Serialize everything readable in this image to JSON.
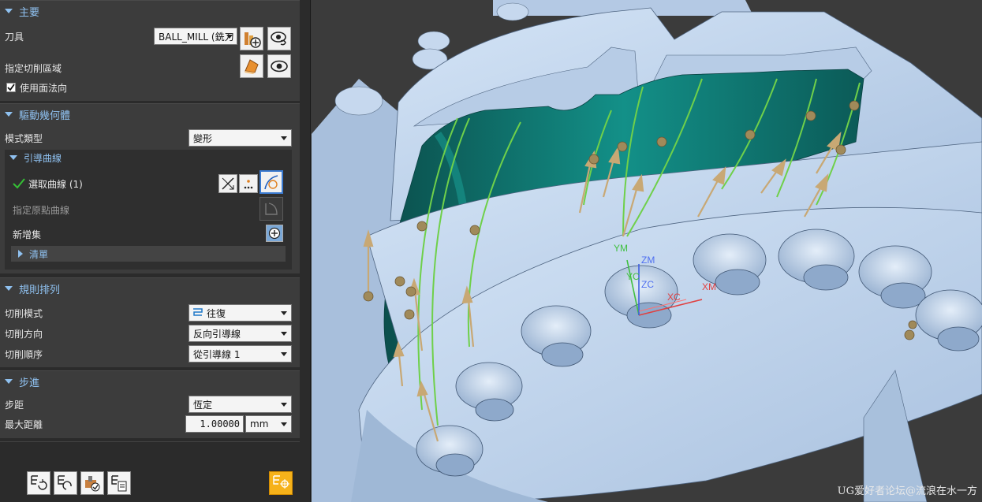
{
  "colors": {
    "panel_bg": "#2b2b2b",
    "group_bg": "#3c3c3c",
    "accent_header": "#8fc1f0",
    "part_blue": "#bcd2ec",
    "part_teal": "#0f6f6a",
    "guide_curve": "#6fd04a",
    "tool_arrow": "#c8a874",
    "axis_red": "#e04040",
    "axis_green": "#40c040",
    "axis_blue": "#4060e0"
  },
  "main": {
    "header": "主要",
    "tool_label": "刀具",
    "tool_value": "BALL_MILL (銑刀",
    "tool_new_icon": "new-tool-icon",
    "tool_display_icon": "display-tool-icon",
    "cut_area_label": "指定切削區域",
    "cut_area_icon": "cut-area-icon",
    "cut_area_display_icon": "display-eye-icon",
    "use_face_normal_label": "使用面法向",
    "use_face_normal_checked": true
  },
  "drive": {
    "header": "驅動幾何體",
    "mode_type_label": "模式類型",
    "mode_type_value": "變形",
    "guide_curves": {
      "header": "引導曲線",
      "select_curve_label": "選取曲線 (1)",
      "specify_origin_label": "指定原點曲線",
      "add_set_label": "新增集",
      "list_label": "清單"
    }
  },
  "pattern": {
    "header": "規則排列",
    "cut_mode_label": "切削模式",
    "cut_mode_value": "往復",
    "cut_direction_label": "切削方向",
    "cut_direction_value": "反向引導線",
    "cut_order_label": "切削順序",
    "cut_order_value": "從引導線 1"
  },
  "stepover": {
    "header": "步進",
    "step_label": "步距",
    "step_value": "恆定",
    "max_distance_label": "最大距離",
    "max_distance_value": "1.00000",
    "max_distance_unit": "mm"
  },
  "viewport": {
    "axis_labels": {
      "ym": "YM",
      "zm": "ZM",
      "yc": "YC",
      "zc": "ZC",
      "xc": "XC",
      "xm": "XM"
    },
    "watermark": "UG爱好者论坛@流浪在水一方"
  }
}
